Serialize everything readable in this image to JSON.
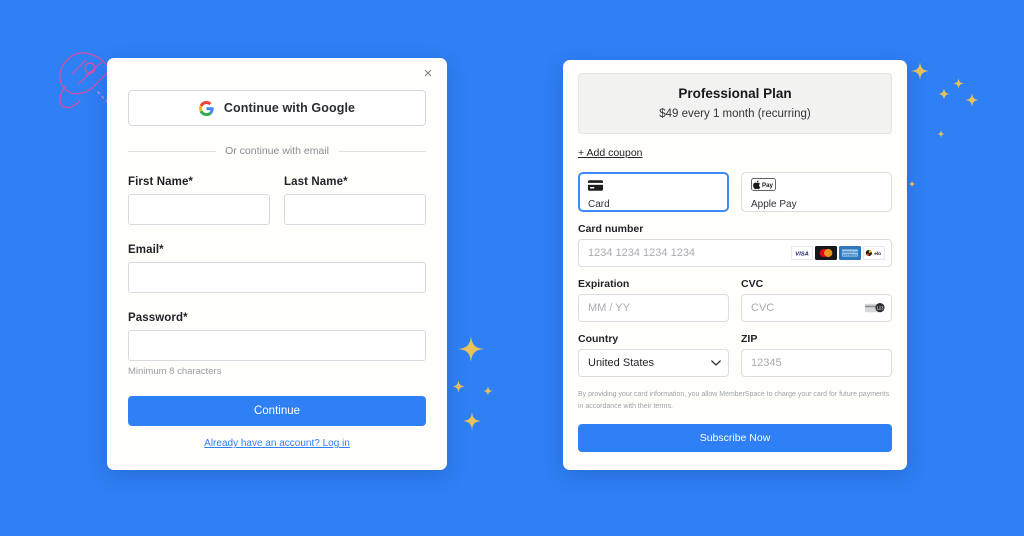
{
  "theme": {
    "background": "#2F7FF5",
    "accent": "#2F7FF5",
    "card_background": "#FFFEFB",
    "sparkle_color": "#E8C35A",
    "rocket_color": "#D94FA0"
  },
  "signup": {
    "close_label": "×",
    "google_button": "Continue with Google",
    "divider_text": "Or continue with email",
    "fields": {
      "first_name": {
        "label": "First Name*",
        "value": "",
        "placeholder": ""
      },
      "last_name": {
        "label": "Last Name*",
        "value": "",
        "placeholder": ""
      },
      "email": {
        "label": "Email*",
        "value": "",
        "placeholder": ""
      },
      "password": {
        "label": "Password*",
        "value": "",
        "placeholder": "",
        "hint": "Minimum 8 characters"
      }
    },
    "submit_label": "Continue",
    "login_link": "Already have an account? Log in"
  },
  "checkout": {
    "plan": {
      "name": "Professional Plan",
      "price_text": "$49 every 1 month (recurring)"
    },
    "coupon_link": "+ Add coupon",
    "payment_methods": [
      {
        "label": "Card",
        "icon": "credit-card-icon",
        "selected": true
      },
      {
        "label": "Apple Pay",
        "icon": "apple-pay-icon",
        "selected": false
      }
    ],
    "card_number": {
      "label": "Card number",
      "value": "",
      "placeholder": "1234 1234 1234 1234",
      "brands": [
        "visa",
        "mastercard",
        "amex",
        "elo"
      ]
    },
    "expiration": {
      "label": "Expiration",
      "value": "",
      "placeholder": "MM / YY"
    },
    "cvc": {
      "label": "CVC",
      "value": "",
      "placeholder": "CVC"
    },
    "country": {
      "label": "Country",
      "value": "United States",
      "options": [
        "United States"
      ]
    },
    "zip": {
      "label": "ZIP",
      "value": "",
      "placeholder": "12345"
    },
    "disclaimer": "By providing your card information, you allow MemberSpace to charge your card for future payments in accordance with their terms.",
    "submit_label": "Subscribe Now"
  }
}
